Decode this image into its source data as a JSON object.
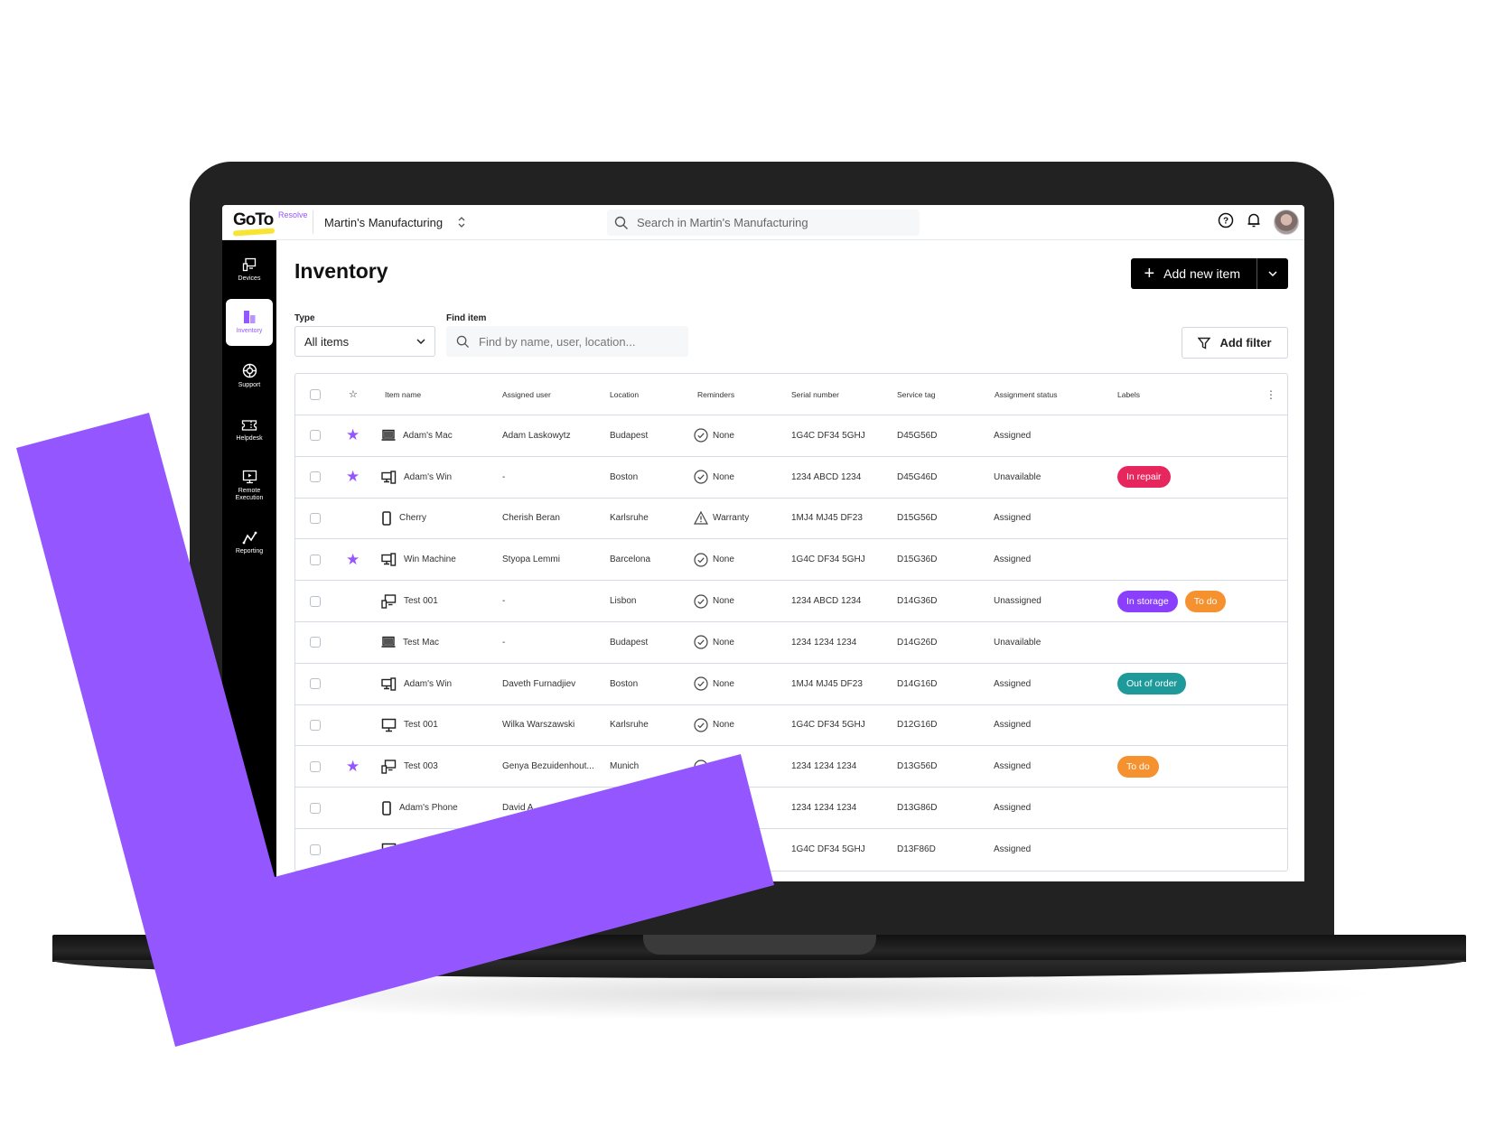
{
  "app": {
    "logo": "GoTo",
    "logo_suffix": "Resolve",
    "organization": "Martin's Manufacturing",
    "global_search_placeholder": "Search in Martin's Manufacturing"
  },
  "sidebar": {
    "items": [
      {
        "label": "Devices",
        "icon": "devices-icon",
        "active": false
      },
      {
        "label": "Inventory",
        "icon": "inventory-icon",
        "active": true
      },
      {
        "label": "Support",
        "icon": "support-icon",
        "active": false
      },
      {
        "label": "Helpdesk",
        "icon": "helpdesk-icon",
        "active": false
      },
      {
        "label": "Remote Execution",
        "icon": "remote-execution-icon",
        "active": false
      },
      {
        "label": "Reporting",
        "icon": "reporting-icon",
        "active": false
      }
    ]
  },
  "page": {
    "title": "Inventory",
    "add_new_item_label": "Add new item",
    "type_label": "Type",
    "type_value": "All items",
    "find_label": "Find item",
    "find_placeholder": "Find by name, user, location...",
    "add_filter_label": "Add filter"
  },
  "table": {
    "columns": [
      "Item name",
      "Assigned user",
      "Location",
      "Reminders",
      "Serial number",
      "Service tag",
      "Assignment status",
      "Labels"
    ],
    "rows": [
      {
        "starred": true,
        "device": "laptop",
        "name": "Adam's Mac",
        "user": "Adam Laskowytz",
        "location": "Budapest",
        "reminder": "None",
        "reminder_icon": "check",
        "serial": "1G4C DF34 5GHJ",
        "tag": "D45G56D",
        "status": "Assigned",
        "labels": []
      },
      {
        "starred": true,
        "device": "desktop-phone",
        "name": "Adam's Win",
        "user": "-",
        "location": "Boston",
        "reminder": "None",
        "reminder_icon": "check",
        "serial": "1234 ABCD 1234",
        "tag": "D45G46D",
        "status": "Unavailable",
        "labels": [
          {
            "text": "In repair",
            "color": "#e8265e"
          }
        ]
      },
      {
        "starred": false,
        "device": "phone",
        "name": "Cherry",
        "user": "Cherish Beran",
        "location": "Karlsruhe",
        "reminder": "Warranty",
        "reminder_icon": "warning",
        "serial": "1MJ4 MJ45 DF23",
        "tag": "D15G56D",
        "status": "Assigned",
        "labels": []
      },
      {
        "starred": true,
        "device": "desktop-phone",
        "name": "Win Machine",
        "user": "Styopa Lemmi",
        "location": "Barcelona",
        "reminder": "None",
        "reminder_icon": "check",
        "serial": "1G4C DF34 5GHJ",
        "tag": "D15G36D",
        "status": "Assigned",
        "labels": []
      },
      {
        "starred": false,
        "device": "devices",
        "name": "Test 001",
        "user": "-",
        "location": "Lisbon",
        "reminder": "None",
        "reminder_icon": "check",
        "serial": "1234 ABCD 1234",
        "tag": "D14G36D",
        "status": "Unassigned",
        "labels": [
          {
            "text": "In storage",
            "color": "#8a3ffc"
          },
          {
            "text": "To do",
            "color": "#f6912f"
          }
        ]
      },
      {
        "starred": false,
        "device": "laptop",
        "name": "Test Mac",
        "user": "-",
        "location": "Budapest",
        "reminder": "None",
        "reminder_icon": "check",
        "serial": "1234 1234 1234",
        "tag": "D14G26D",
        "status": "Unavailable",
        "labels": []
      },
      {
        "starred": false,
        "device": "desktop-phone",
        "name": "Adam's Win",
        "user": "Daveth Furnadjiev",
        "location": "Boston",
        "reminder": "None",
        "reminder_icon": "check",
        "serial": "1MJ4 MJ45 DF23",
        "tag": "D14G16D",
        "status": "Assigned",
        "labels": [
          {
            "text": "Out of order",
            "color": "#1e9a9a"
          }
        ]
      },
      {
        "starred": false,
        "device": "monitor",
        "name": "Test 001",
        "user": "Wilka Warszawski",
        "location": "Karlsruhe",
        "reminder": "None",
        "reminder_icon": "check",
        "serial": "1G4C DF34 5GHJ",
        "tag": "D12G16D",
        "status": "Assigned",
        "labels": []
      },
      {
        "starred": true,
        "device": "devices",
        "name": "Test 003",
        "user": "Genya Bezuidenhout...",
        "location": "Munich",
        "reminder": "",
        "reminder_icon": "check",
        "serial": "1234 1234 1234",
        "tag": "D13G56D",
        "status": "Assigned",
        "labels": [
          {
            "text": "To do",
            "color": "#f6912f"
          }
        ]
      },
      {
        "starred": false,
        "device": "phone",
        "name": "Adam's Phone",
        "user": "David A...",
        "location": "",
        "reminder": "",
        "reminder_icon": "",
        "serial": "1234 1234 1234",
        "tag": "D13G86D",
        "status": "Assigned",
        "labels": []
      },
      {
        "starred": false,
        "device": "desktop",
        "name": "",
        "user": "",
        "location": "",
        "reminder": "",
        "reminder_icon": "",
        "serial": "1G4C DF34 5GHJ",
        "tag": "D13F86D",
        "status": "Assigned",
        "labels": []
      }
    ]
  },
  "colors": {
    "accent": "#9457ff",
    "sidebar_bg": "#000000",
    "logo_yellow": "#f7e531"
  }
}
